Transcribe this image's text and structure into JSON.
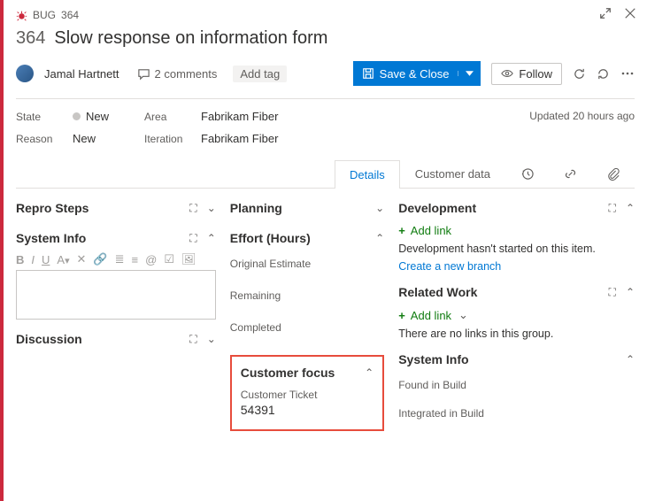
{
  "breadcrumb": {
    "type": "BUG",
    "id": "364"
  },
  "title": {
    "id": "364",
    "text": "Slow response on information form"
  },
  "assignee": "Jamal Hartnett",
  "comments": "2 comments",
  "addtag": "Add tag",
  "save": "Save & Close",
  "follow": "Follow",
  "fields": {
    "state_label": "State",
    "state_value": "New",
    "reason_label": "Reason",
    "reason_value": "New",
    "area_label": "Area",
    "area_value": "Fabrikam Fiber",
    "iteration_label": "Iteration",
    "iteration_value": "Fabrikam Fiber"
  },
  "updated": "Updated 20 hours ago",
  "tabs": {
    "details": "Details",
    "customer": "Customer data"
  },
  "left": {
    "repro": "Repro Steps",
    "sysinfo": "System Info",
    "discussion": "Discussion"
  },
  "mid": {
    "planning": "Planning",
    "effort": "Effort (Hours)",
    "orig": "Original Estimate",
    "remaining": "Remaining",
    "completed": "Completed",
    "focus": "Customer focus",
    "ticket_label": "Customer Ticket",
    "ticket_value": "54391"
  },
  "right": {
    "dev": "Development",
    "addlink": "Add link",
    "dev_msg": "Development hasn't started on this item.",
    "branch": "Create a new branch",
    "related": "Related Work",
    "addlink2": "Add link",
    "nolinks": "There are no links in this group.",
    "sysinfo": "System Info",
    "found": "Found in Build",
    "integrated": "Integrated in Build"
  }
}
